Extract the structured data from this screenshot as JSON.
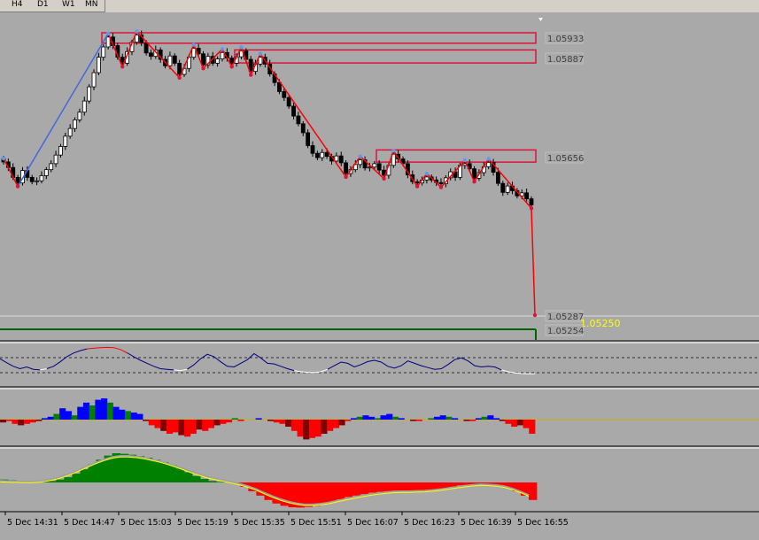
{
  "toolbar": {
    "timeframes": [
      "H4",
      "D1",
      "W1",
      "MN"
    ]
  },
  "price_chart": {
    "resistance_zones": [
      {
        "top": 1.05945,
        "bottom": 1.05933,
        "label": "1.05933"
      },
      {
        "top": 1.05905,
        "bottom": 1.05887,
        "label": "1.05887"
      },
      {
        "top": 1.05672,
        "bottom": 1.05656,
        "label": "1.05656"
      }
    ],
    "support_line": {
      "price": 1.05254,
      "label": "1.05254"
    },
    "last_price": {
      "price": 1.05287,
      "label": "1.05287"
    },
    "overlay_text": "1.05250",
    "candles_close": [
      1.05644,
      1.05631,
      1.05608,
      1.05595,
      1.05624,
      1.05608,
      1.05598,
      1.056,
      1.05612,
      1.05626,
      1.0564,
      1.0566,
      1.0568,
      1.05704,
      1.05722,
      1.05742,
      1.0576,
      1.05786,
      1.05819,
      1.05852,
      1.05888,
      1.05912,
      1.05935,
      1.05915,
      1.05888,
      1.05874,
      1.05901,
      1.05923,
      1.0594,
      1.05922,
      1.05898,
      1.0589,
      1.05905,
      1.05883,
      1.05868,
      1.05891,
      1.05874,
      1.05848,
      1.05862,
      1.05888,
      1.05909,
      1.05896,
      1.0587,
      1.0589,
      1.05874,
      1.05884,
      1.05899,
      1.05886,
      1.05874,
      1.05889,
      1.05903,
      1.05883,
      1.05855,
      1.05872,
      1.05888,
      1.05872,
      1.05849,
      1.05829,
      1.05808,
      1.05794,
      1.05774,
      1.05751,
      1.05733,
      1.05712,
      1.05682,
      1.05664,
      1.05654,
      1.05666,
      1.05657,
      1.05646,
      1.05658,
      1.05642,
      1.05617,
      1.05626,
      1.05638,
      1.05649,
      1.0563,
      1.05632,
      1.0564,
      1.05625,
      1.05613,
      1.05636,
      1.05662,
      1.05651,
      1.0564,
      1.05614,
      1.05598,
      1.05595,
      1.05602,
      1.05609,
      1.05602,
      1.05596,
      1.05593,
      1.05607,
      1.05621,
      1.05608,
      1.05636,
      1.0564,
      1.05628,
      1.05606,
      1.05619,
      1.05633,
      1.05643,
      1.0562,
      1.05594,
      1.05573,
      1.05588,
      1.05577,
      1.05565,
      1.05572,
      1.05558,
      1.05544
    ]
  },
  "indicator1": {
    "levels": [
      "upper-dashed",
      "lower-dashed"
    ],
    "series": [
      0.55,
      0.42,
      0.3,
      0.22,
      0.28,
      0.2,
      0.18,
      0.22,
      0.3,
      0.45,
      0.62,
      0.74,
      0.82,
      0.88,
      0.9,
      0.92,
      0.93,
      0.92,
      0.86,
      0.75,
      0.62,
      0.5,
      0.4,
      0.3,
      0.22,
      0.2,
      0.18,
      0.16,
      0.2,
      0.35,
      0.55,
      0.7,
      0.62,
      0.45,
      0.3,
      0.28,
      0.4,
      0.52,
      0.72,
      0.58,
      0.4,
      0.38,
      0.3,
      0.22,
      0.16,
      0.12,
      0.1,
      0.09,
      0.12,
      0.2,
      0.32,
      0.44,
      0.4,
      0.28,
      0.36,
      0.46,
      0.5,
      0.44,
      0.3,
      0.24,
      0.32,
      0.48,
      0.4,
      0.32,
      0.26,
      0.2,
      0.22,
      0.36,
      0.52,
      0.58,
      0.48,
      0.32,
      0.28,
      0.3,
      0.28,
      0.18,
      0.12,
      0.08,
      0.06,
      0.05,
      0.05
    ]
  },
  "indicator2": {
    "bars": [
      -2,
      -1,
      -3,
      -4,
      -3,
      -2,
      -1,
      1,
      2,
      4,
      8,
      6,
      3,
      9,
      12,
      10,
      14,
      15,
      12,
      9,
      7,
      6,
      5,
      4,
      -1,
      -4,
      -6,
      -8,
      -10,
      -9,
      -11,
      -12,
      -10,
      -7,
      -8,
      -6,
      -4,
      -3,
      -2,
      1,
      -1,
      0,
      0,
      1,
      0,
      -1,
      -2,
      -3,
      -5,
      -8,
      -12,
      -14,
      -13,
      -12,
      -10,
      -8,
      -6,
      -4,
      -1,
      1,
      2,
      3,
      2,
      1,
      3,
      4,
      2,
      1,
      0,
      -1,
      -1,
      0,
      1,
      2,
      3,
      2,
      1,
      0,
      -1,
      -1,
      1,
      2,
      3,
      1,
      -1,
      -3,
      -5,
      -4,
      -6,
      -10
    ],
    "colors": [
      "#ff0000",
      "#000000",
      "#0000ff",
      "#008000"
    ]
  },
  "indicator3": {
    "histogram": [
      0.1,
      0.08,
      0.05,
      0.03,
      0.02,
      0.03,
      0.05,
      0.1,
      0.18,
      0.3,
      0.45,
      0.62,
      0.78,
      0.92,
      1.0,
      0.98,
      0.95,
      0.9,
      0.85,
      0.78,
      0.7,
      0.6,
      0.48,
      0.35,
      0.22,
      0.12,
      0.05,
      0.02,
      0.0,
      -0.05,
      -0.15,
      -0.3,
      -0.45,
      -0.6,
      -0.72,
      -0.8,
      -0.85,
      -0.86,
      -0.84,
      -0.8,
      -0.72,
      -0.65,
      -0.58,
      -0.5,
      -0.45,
      -0.4,
      -0.35,
      -0.32,
      -0.3,
      -0.28,
      -0.3,
      -0.32,
      -0.3,
      -0.28,
      -0.25,
      -0.2,
      -0.15,
      -0.1,
      -0.08,
      -0.06,
      -0.05,
      -0.08,
      -0.12,
      -0.18,
      -0.3,
      -0.45,
      -0.6
    ],
    "signal": [
      0.05,
      0.04,
      0.03,
      0.02,
      0.02,
      0.04,
      0.08,
      0.14,
      0.22,
      0.32,
      0.44,
      0.56,
      0.68,
      0.78,
      0.86,
      0.9,
      0.9,
      0.88,
      0.84,
      0.78,
      0.72,
      0.64,
      0.55,
      0.45,
      0.35,
      0.26,
      0.18,
      0.12,
      0.06,
      0.0,
      -0.06,
      -0.14,
      -0.24,
      -0.36,
      -0.48,
      -0.58,
      -0.66,
      -0.72,
      -0.76,
      -0.76,
      -0.74,
      -0.7,
      -0.64,
      -0.58,
      -0.52,
      -0.47,
      -0.42,
      -0.38,
      -0.35,
      -0.32,
      -0.31,
      -0.31,
      -0.3,
      -0.29,
      -0.27,
      -0.24,
      -0.2,
      -0.16,
      -0.12,
      -0.09,
      -0.07,
      -0.08,
      -0.1,
      -0.14,
      -0.22,
      -0.32,
      -0.44
    ]
  },
  "time_axis": {
    "labels": [
      "5 Dec 14:31",
      "5 Dec 14:47",
      "5 Dec 15:03",
      "5 Dec 15:19",
      "5 Dec 15:35",
      "5 Dec 15:51",
      "5 Dec 16:07",
      "5 Dec 16:23",
      "5 Dec 16:39",
      "5 Dec 16:55"
    ]
  },
  "colors": {
    "background": "#a9a9a9",
    "zone": "#dc143c",
    "zigzag": "#ff0000",
    "uptrend": "#4169e1",
    "support": "#006400",
    "overlay_text": "#ffff00",
    "label_text": "#404040"
  }
}
